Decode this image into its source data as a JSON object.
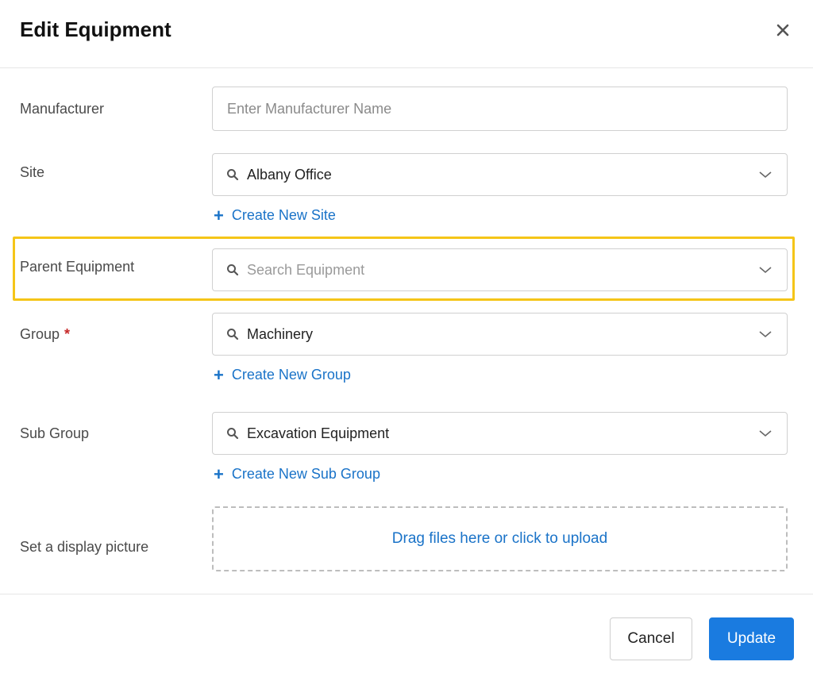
{
  "dialog": {
    "title": "Edit Equipment",
    "close_icon": "close-icon"
  },
  "form": {
    "manufacturer": {
      "label": "Manufacturer",
      "value": "",
      "placeholder": "Enter Manufacturer Name"
    },
    "site": {
      "label": "Site",
      "value": "Albany Office",
      "create_label": "Create New Site"
    },
    "parent_equipment": {
      "label": "Parent Equipment",
      "value": "",
      "placeholder": "Search Equipment"
    },
    "group": {
      "label": "Group",
      "required_marker": "*",
      "value": "Machinery",
      "create_label": "Create New Group"
    },
    "sub_group": {
      "label": "Sub Group",
      "value": "Excavation Equipment",
      "create_label": "Create New Sub Group"
    },
    "display_picture": {
      "label": "Set a display picture",
      "upload_text": "Drag files here or click to upload"
    }
  },
  "footer": {
    "cancel_label": "Cancel",
    "update_label": "Update"
  },
  "colors": {
    "accent": "#1a73c8",
    "primary_button": "#1a7be0",
    "highlight": "#f5c518",
    "required": "#c62828"
  },
  "icons": {
    "search": "search-icon",
    "chevron": "chevron-down-icon",
    "plus": "plus-icon"
  }
}
